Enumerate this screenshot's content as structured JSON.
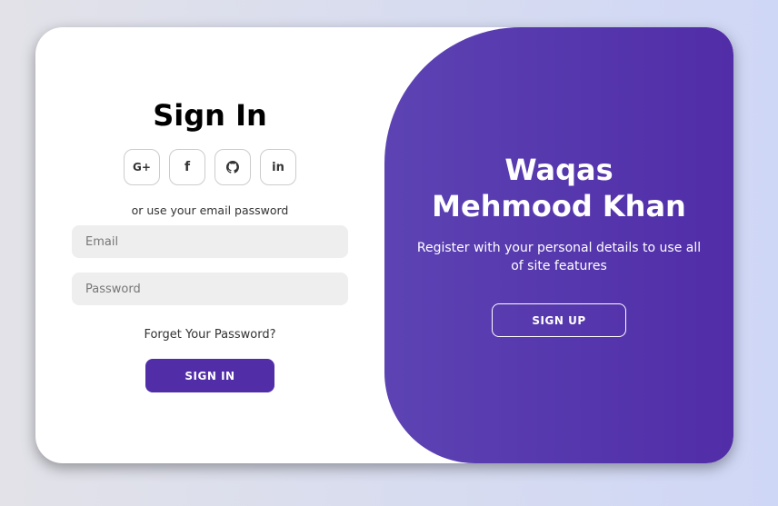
{
  "signin": {
    "title": "Sign In",
    "socials": [
      {
        "label": "G+",
        "icon": "google-plus-icon"
      },
      {
        "label": "f",
        "icon": "facebook-icon"
      },
      {
        "label": "",
        "icon": "github-icon"
      },
      {
        "label": "in",
        "icon": "linkedin-icon"
      }
    ],
    "alt_text": "or use your email password",
    "email_placeholder": "Email",
    "password_placeholder": "Password",
    "forgot_label": "Forget Your Password?",
    "button_label": "SIGN IN"
  },
  "panel": {
    "title": "Waqas Mehmood Khan",
    "text": "Register with your personal details to use all of site features",
    "button_label": "SIGN UP"
  },
  "colors": {
    "accent": "#512da8",
    "panel_start": "#5c43b3",
    "field_bg": "#eeeeee"
  }
}
